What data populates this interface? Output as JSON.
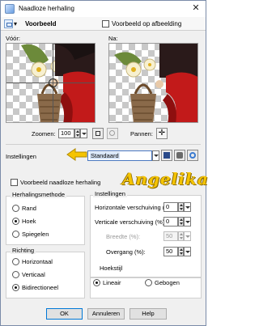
{
  "window": {
    "title": "Naadloze herhaling",
    "close_glyph": "✕"
  },
  "toolbar": {
    "preview_label": "Voorbeeld",
    "preview_on_image_label": "Voorbeeld op afbeelding"
  },
  "previews": {
    "before_label": "Vóór:",
    "after_label": "Na:"
  },
  "zoom": {
    "label": "Zoomen:",
    "value": "100",
    "pan_label": "Pannen:"
  },
  "settings": {
    "label": "Instellingen",
    "preset": "Standaard"
  },
  "watermark": {
    "text": "Angelika"
  },
  "seamless_preview_label": "Voorbeeld naadloze herhaling",
  "method": {
    "title": "Herhalingsmethode",
    "options": [
      "Rand",
      "Hoek",
      "Spiegelen"
    ],
    "selected": "Hoek"
  },
  "direction": {
    "title": "Richting",
    "options": [
      "Horizontaal",
      "Verticaal",
      "Bidirectioneel"
    ],
    "selected": "Bidirectioneel"
  },
  "params": {
    "title": "Instellingen",
    "h_shift_label": "Horizontale verschuiving (%):",
    "h_shift": "0",
    "v_shift_label": "Verticale verschuiving (%):",
    "v_shift": "0",
    "width_label": "Breedte (%):",
    "width": "50",
    "transition_label": "Overgang (%):",
    "transition": "50"
  },
  "corner": {
    "title": "Hoekstijl",
    "options": [
      "Lineair",
      "Gebogen"
    ],
    "selected": "Lineair"
  },
  "buttons": {
    "ok": "OK",
    "cancel": "Annuleren",
    "help": "Help"
  },
  "colors": {
    "accent": "#0078d7",
    "arrow": "#f5c400"
  }
}
